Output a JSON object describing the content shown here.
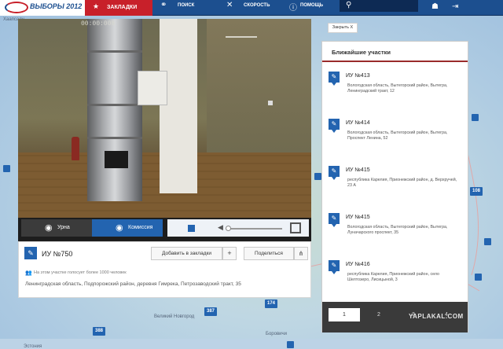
{
  "nav": {
    "logo_text": "ВЫБОРЫ 2012",
    "bookmarks_label": "ЗАКЛАДКИ",
    "search_label": "ПОИСК",
    "speed_label": "СКОРОСТЬ",
    "help_label": "ПОМОЩЬ"
  },
  "video": {
    "timestamp": "00:00:008",
    "urn_label": "Урна",
    "commission_label": "Комиссия"
  },
  "info": {
    "title": "ИУ №750",
    "add_bookmark_label": "Добавить в закладки",
    "plus_label": "+",
    "share_label": "Поделиться",
    "note": "На этом участке голосует более 1000 человек",
    "address": "Ленинградская область, Подпорожский район, деревня Гимрека, Петрозаводский тракт, 35"
  },
  "close_label": "Закрыть X",
  "nearby": {
    "title": "Ближайшие участки",
    "items": [
      {
        "title": "ИУ №413",
        "address": "Вологодская область, Вытегорский район, Вытегра, Ленинградский тракт, 12"
      },
      {
        "title": "ИУ №414",
        "address": "Вологодская область, Вытегорский район, Вытегра, Проспект Ленина, 52"
      },
      {
        "title": "ИУ №415",
        "address": "республика Карелия, Прионежский район, д. Верхручей, 23 А"
      },
      {
        "title": "ИУ №415",
        "address": "Вологодская область, Вытегорский район, Вытегра, Луначарского проспект, 35"
      },
      {
        "title": "ИУ №416",
        "address": "республика Карелия, Прионежский район, село Шелтозеро, Лисицыной, 3"
      }
    ],
    "pages": [
      "1",
      "2",
      "3",
      "4"
    ],
    "active_page": "1"
  },
  "map": {
    "labels": [
      "Хаапсалу",
      "Эстония",
      "Великий Новгород",
      "Боровичи"
    ],
    "pins": [
      "174",
      "387",
      "388",
      "108"
    ]
  },
  "watermark": "YAPLAKAL.COM",
  "colors": {
    "nav_bg": "#1c4f8f",
    "accent_red": "#c8202a",
    "accent_blue": "#2364b0",
    "divider": "#9a2b2b"
  },
  "icons": {
    "logo": "elections-logo-icon",
    "bookmarks": "star-icon",
    "search": "binoculars-icon",
    "speed": "wrench-icon",
    "help": "info-icon",
    "user": "user-icon",
    "exit": "exit-icon"
  }
}
